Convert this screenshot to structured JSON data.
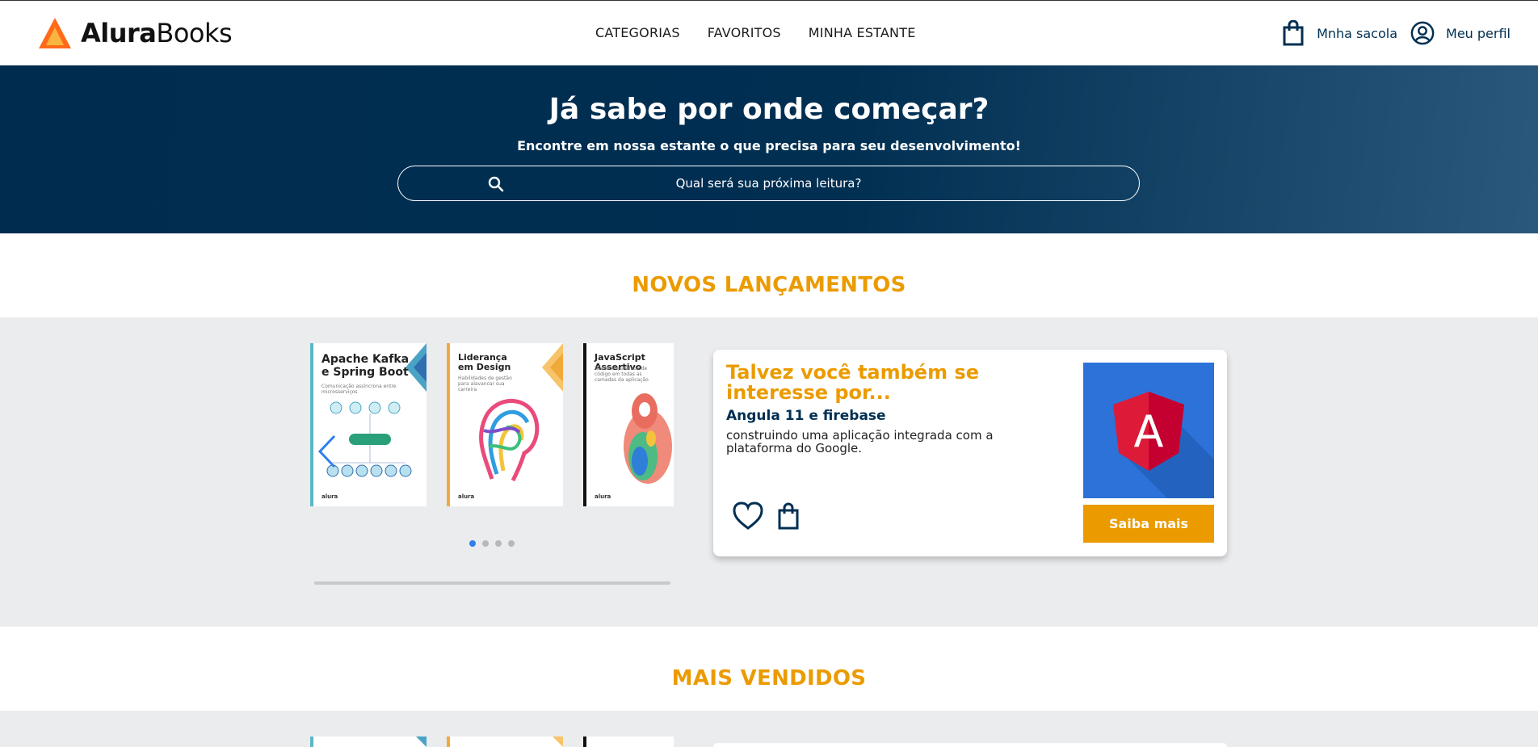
{
  "brand": {
    "name_bold": "Alura",
    "name_regular": "Books"
  },
  "nav": {
    "items": [
      {
        "label": "CATEGORIAS"
      },
      {
        "label": "FAVORITOS"
      },
      {
        "label": "MINHA ESTANTE"
      }
    ]
  },
  "user": {
    "bag_label": "Mnha sacola",
    "profile_label": "Meu perfil"
  },
  "hero": {
    "title": "Já sabe por onde começar?",
    "subtitle": "Encontre em nossa estante o que precisa para seu desenvolvimento!",
    "search_placeholder": "Qual será sua próxima leitura?"
  },
  "sections": [
    {
      "title": "NOVOS LANÇAMENTOS",
      "books": [
        {
          "title": "Apache Kafka e Spring Boot",
          "subtitle": "Comunicação assíncrona entre microsserviços",
          "brand": "alura",
          "color": "#5bb7c6"
        },
        {
          "title": "Liderança em Design",
          "subtitle": "Habilidades de gestão para alavancar sua carreira",
          "brand": "alura",
          "color": "#f2a93b"
        },
        {
          "title": "JavaScript Assertivo",
          "subtitle": "Testes e qualidade de código em todas as camadas da aplicação",
          "brand": "alura",
          "color": "#111111"
        }
      ],
      "carousel": {
        "page_count": 4,
        "active_page": 1
      },
      "suggestion": {
        "heading": "Talvez você também se interesse por...",
        "book_title": "Angula 11 e firebase",
        "description": "construindo uma aplicação integrada com a plataforma do Google.",
        "button_label": "Saiba mais",
        "cover_letter": "A"
      }
    },
    {
      "title": "MAIS VENDIDOS"
    }
  ],
  "colors": {
    "accent": "#eb9b00",
    "primary": "#002f52",
    "carousel_dot_active": "#2f80ed",
    "band": "#ebecee"
  }
}
